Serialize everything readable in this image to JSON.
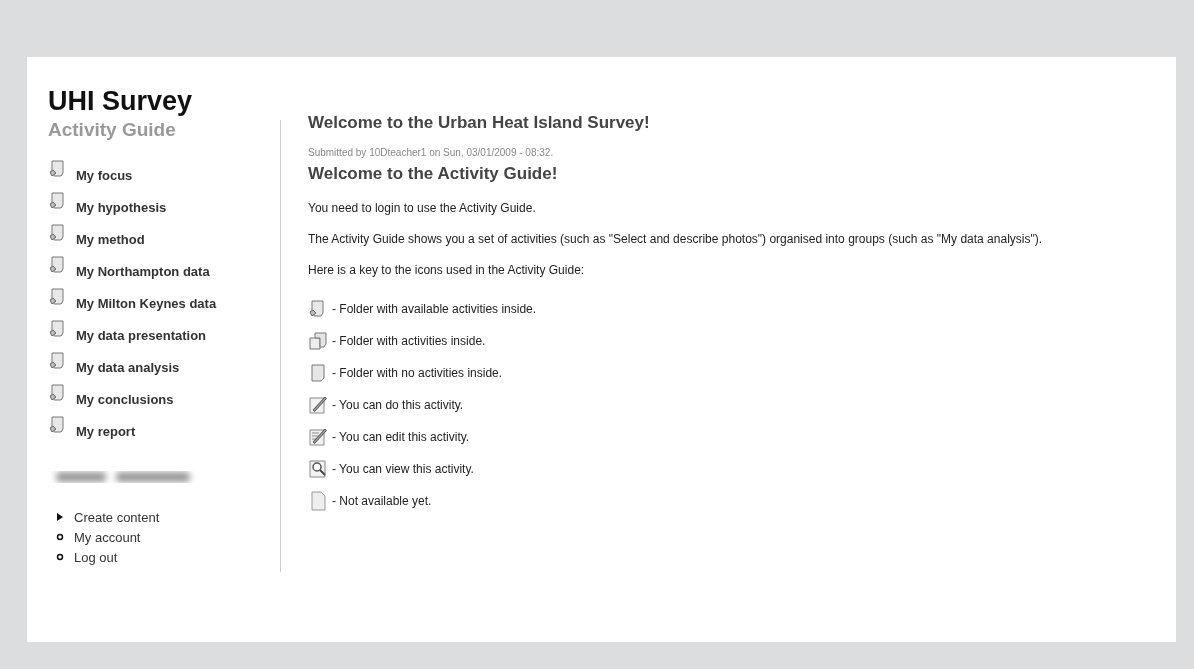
{
  "site": {
    "title": "UHI Survey",
    "subtitle": "Activity Guide"
  },
  "sidebar": {
    "items": [
      {
        "label": "My focus"
      },
      {
        "label": "My hypothesis"
      },
      {
        "label": "My method"
      },
      {
        "label": "My Northampton data"
      },
      {
        "label": "My Milton Keynes data"
      },
      {
        "label": "My data presentation"
      },
      {
        "label": "My data analysis"
      },
      {
        "label": "My conclusions"
      },
      {
        "label": "My report"
      }
    ],
    "user_links": [
      {
        "label": "Create content",
        "kind": "arrow"
      },
      {
        "label": "My account",
        "kind": "circle"
      },
      {
        "label": "Log out",
        "kind": "circle"
      }
    ]
  },
  "content": {
    "title": "Welcome to the Urban Heat Island Survey!",
    "submitted": "Submitted by 10Dteacher1 on Sun, 03/01/2009 - 08:32.",
    "heading": "Welcome to the Activity Guide!",
    "paragraphs": [
      "You need to login to use the Activity Guide.",
      "The Activity Guide shows you a set of activities (such as \"Select and describe photos\") organised into groups (such as \"My data analysis\").",
      "Here is a key to the icons used in the Activity Guide:"
    ],
    "key": [
      {
        "kind": "available",
        "text": "- Folder with available activities inside."
      },
      {
        "kind": "stack",
        "text": "- Folder with activities inside."
      },
      {
        "kind": "empty",
        "text": "- Folder with no activities inside."
      },
      {
        "kind": "do",
        "text": "- You can do this activity."
      },
      {
        "kind": "edit",
        "text": "- You can edit this activity."
      },
      {
        "kind": "view",
        "text": "- You can view this activity."
      },
      {
        "kind": "blank",
        "text": "- Not available yet."
      }
    ]
  }
}
